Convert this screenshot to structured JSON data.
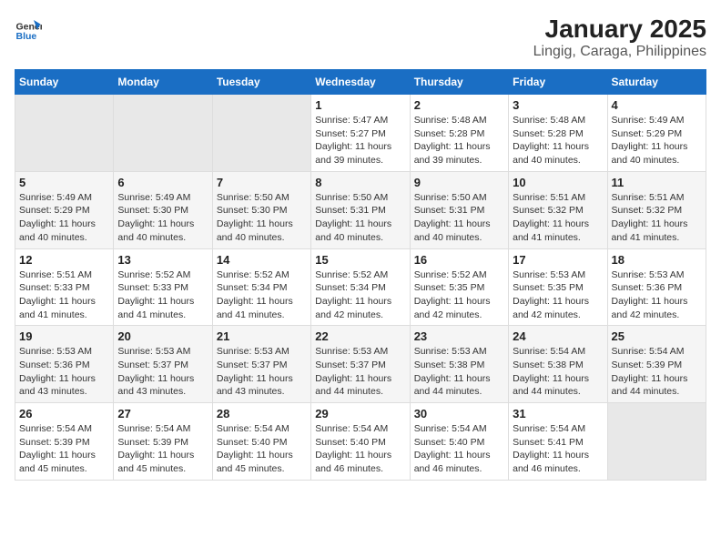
{
  "header": {
    "logo_line1": "General",
    "logo_line2": "Blue",
    "title": "January 2025",
    "subtitle": "Lingig, Caraga, Philippines"
  },
  "calendar": {
    "weekdays": [
      "Sunday",
      "Monday",
      "Tuesday",
      "Wednesday",
      "Thursday",
      "Friday",
      "Saturday"
    ],
    "weeks": [
      [
        {
          "day": "",
          "sunrise": "",
          "sunset": "",
          "daylight": ""
        },
        {
          "day": "",
          "sunrise": "",
          "sunset": "",
          "daylight": ""
        },
        {
          "day": "",
          "sunrise": "",
          "sunset": "",
          "daylight": ""
        },
        {
          "day": "1",
          "sunrise": "Sunrise: 5:47 AM",
          "sunset": "Sunset: 5:27 PM",
          "daylight": "Daylight: 11 hours and 39 minutes."
        },
        {
          "day": "2",
          "sunrise": "Sunrise: 5:48 AM",
          "sunset": "Sunset: 5:28 PM",
          "daylight": "Daylight: 11 hours and 39 minutes."
        },
        {
          "day": "3",
          "sunrise": "Sunrise: 5:48 AM",
          "sunset": "Sunset: 5:28 PM",
          "daylight": "Daylight: 11 hours and 40 minutes."
        },
        {
          "day": "4",
          "sunrise": "Sunrise: 5:49 AM",
          "sunset": "Sunset: 5:29 PM",
          "daylight": "Daylight: 11 hours and 40 minutes."
        }
      ],
      [
        {
          "day": "5",
          "sunrise": "Sunrise: 5:49 AM",
          "sunset": "Sunset: 5:29 PM",
          "daylight": "Daylight: 11 hours and 40 minutes."
        },
        {
          "day": "6",
          "sunrise": "Sunrise: 5:49 AM",
          "sunset": "Sunset: 5:30 PM",
          "daylight": "Daylight: 11 hours and 40 minutes."
        },
        {
          "day": "7",
          "sunrise": "Sunrise: 5:50 AM",
          "sunset": "Sunset: 5:30 PM",
          "daylight": "Daylight: 11 hours and 40 minutes."
        },
        {
          "day": "8",
          "sunrise": "Sunrise: 5:50 AM",
          "sunset": "Sunset: 5:31 PM",
          "daylight": "Daylight: 11 hours and 40 minutes."
        },
        {
          "day": "9",
          "sunrise": "Sunrise: 5:50 AM",
          "sunset": "Sunset: 5:31 PM",
          "daylight": "Daylight: 11 hours and 40 minutes."
        },
        {
          "day": "10",
          "sunrise": "Sunrise: 5:51 AM",
          "sunset": "Sunset: 5:32 PM",
          "daylight": "Daylight: 11 hours and 41 minutes."
        },
        {
          "day": "11",
          "sunrise": "Sunrise: 5:51 AM",
          "sunset": "Sunset: 5:32 PM",
          "daylight": "Daylight: 11 hours and 41 minutes."
        }
      ],
      [
        {
          "day": "12",
          "sunrise": "Sunrise: 5:51 AM",
          "sunset": "Sunset: 5:33 PM",
          "daylight": "Daylight: 11 hours and 41 minutes."
        },
        {
          "day": "13",
          "sunrise": "Sunrise: 5:52 AM",
          "sunset": "Sunset: 5:33 PM",
          "daylight": "Daylight: 11 hours and 41 minutes."
        },
        {
          "day": "14",
          "sunrise": "Sunrise: 5:52 AM",
          "sunset": "Sunset: 5:34 PM",
          "daylight": "Daylight: 11 hours and 41 minutes."
        },
        {
          "day": "15",
          "sunrise": "Sunrise: 5:52 AM",
          "sunset": "Sunset: 5:34 PM",
          "daylight": "Daylight: 11 hours and 42 minutes."
        },
        {
          "day": "16",
          "sunrise": "Sunrise: 5:52 AM",
          "sunset": "Sunset: 5:35 PM",
          "daylight": "Daylight: 11 hours and 42 minutes."
        },
        {
          "day": "17",
          "sunrise": "Sunrise: 5:53 AM",
          "sunset": "Sunset: 5:35 PM",
          "daylight": "Daylight: 11 hours and 42 minutes."
        },
        {
          "day": "18",
          "sunrise": "Sunrise: 5:53 AM",
          "sunset": "Sunset: 5:36 PM",
          "daylight": "Daylight: 11 hours and 42 minutes."
        }
      ],
      [
        {
          "day": "19",
          "sunrise": "Sunrise: 5:53 AM",
          "sunset": "Sunset: 5:36 PM",
          "daylight": "Daylight: 11 hours and 43 minutes."
        },
        {
          "day": "20",
          "sunrise": "Sunrise: 5:53 AM",
          "sunset": "Sunset: 5:37 PM",
          "daylight": "Daylight: 11 hours and 43 minutes."
        },
        {
          "day": "21",
          "sunrise": "Sunrise: 5:53 AM",
          "sunset": "Sunset: 5:37 PM",
          "daylight": "Daylight: 11 hours and 43 minutes."
        },
        {
          "day": "22",
          "sunrise": "Sunrise: 5:53 AM",
          "sunset": "Sunset: 5:37 PM",
          "daylight": "Daylight: 11 hours and 44 minutes."
        },
        {
          "day": "23",
          "sunrise": "Sunrise: 5:53 AM",
          "sunset": "Sunset: 5:38 PM",
          "daylight": "Daylight: 11 hours and 44 minutes."
        },
        {
          "day": "24",
          "sunrise": "Sunrise: 5:54 AM",
          "sunset": "Sunset: 5:38 PM",
          "daylight": "Daylight: 11 hours and 44 minutes."
        },
        {
          "day": "25",
          "sunrise": "Sunrise: 5:54 AM",
          "sunset": "Sunset: 5:39 PM",
          "daylight": "Daylight: 11 hours and 44 minutes."
        }
      ],
      [
        {
          "day": "26",
          "sunrise": "Sunrise: 5:54 AM",
          "sunset": "Sunset: 5:39 PM",
          "daylight": "Daylight: 11 hours and 45 minutes."
        },
        {
          "day": "27",
          "sunrise": "Sunrise: 5:54 AM",
          "sunset": "Sunset: 5:39 PM",
          "daylight": "Daylight: 11 hours and 45 minutes."
        },
        {
          "day": "28",
          "sunrise": "Sunrise: 5:54 AM",
          "sunset": "Sunset: 5:40 PM",
          "daylight": "Daylight: 11 hours and 45 minutes."
        },
        {
          "day": "29",
          "sunrise": "Sunrise: 5:54 AM",
          "sunset": "Sunset: 5:40 PM",
          "daylight": "Daylight: 11 hours and 46 minutes."
        },
        {
          "day": "30",
          "sunrise": "Sunrise: 5:54 AM",
          "sunset": "Sunset: 5:40 PM",
          "daylight": "Daylight: 11 hours and 46 minutes."
        },
        {
          "day": "31",
          "sunrise": "Sunrise: 5:54 AM",
          "sunset": "Sunset: 5:41 PM",
          "daylight": "Daylight: 11 hours and 46 minutes."
        },
        {
          "day": "",
          "sunrise": "",
          "sunset": "",
          "daylight": ""
        }
      ]
    ]
  }
}
